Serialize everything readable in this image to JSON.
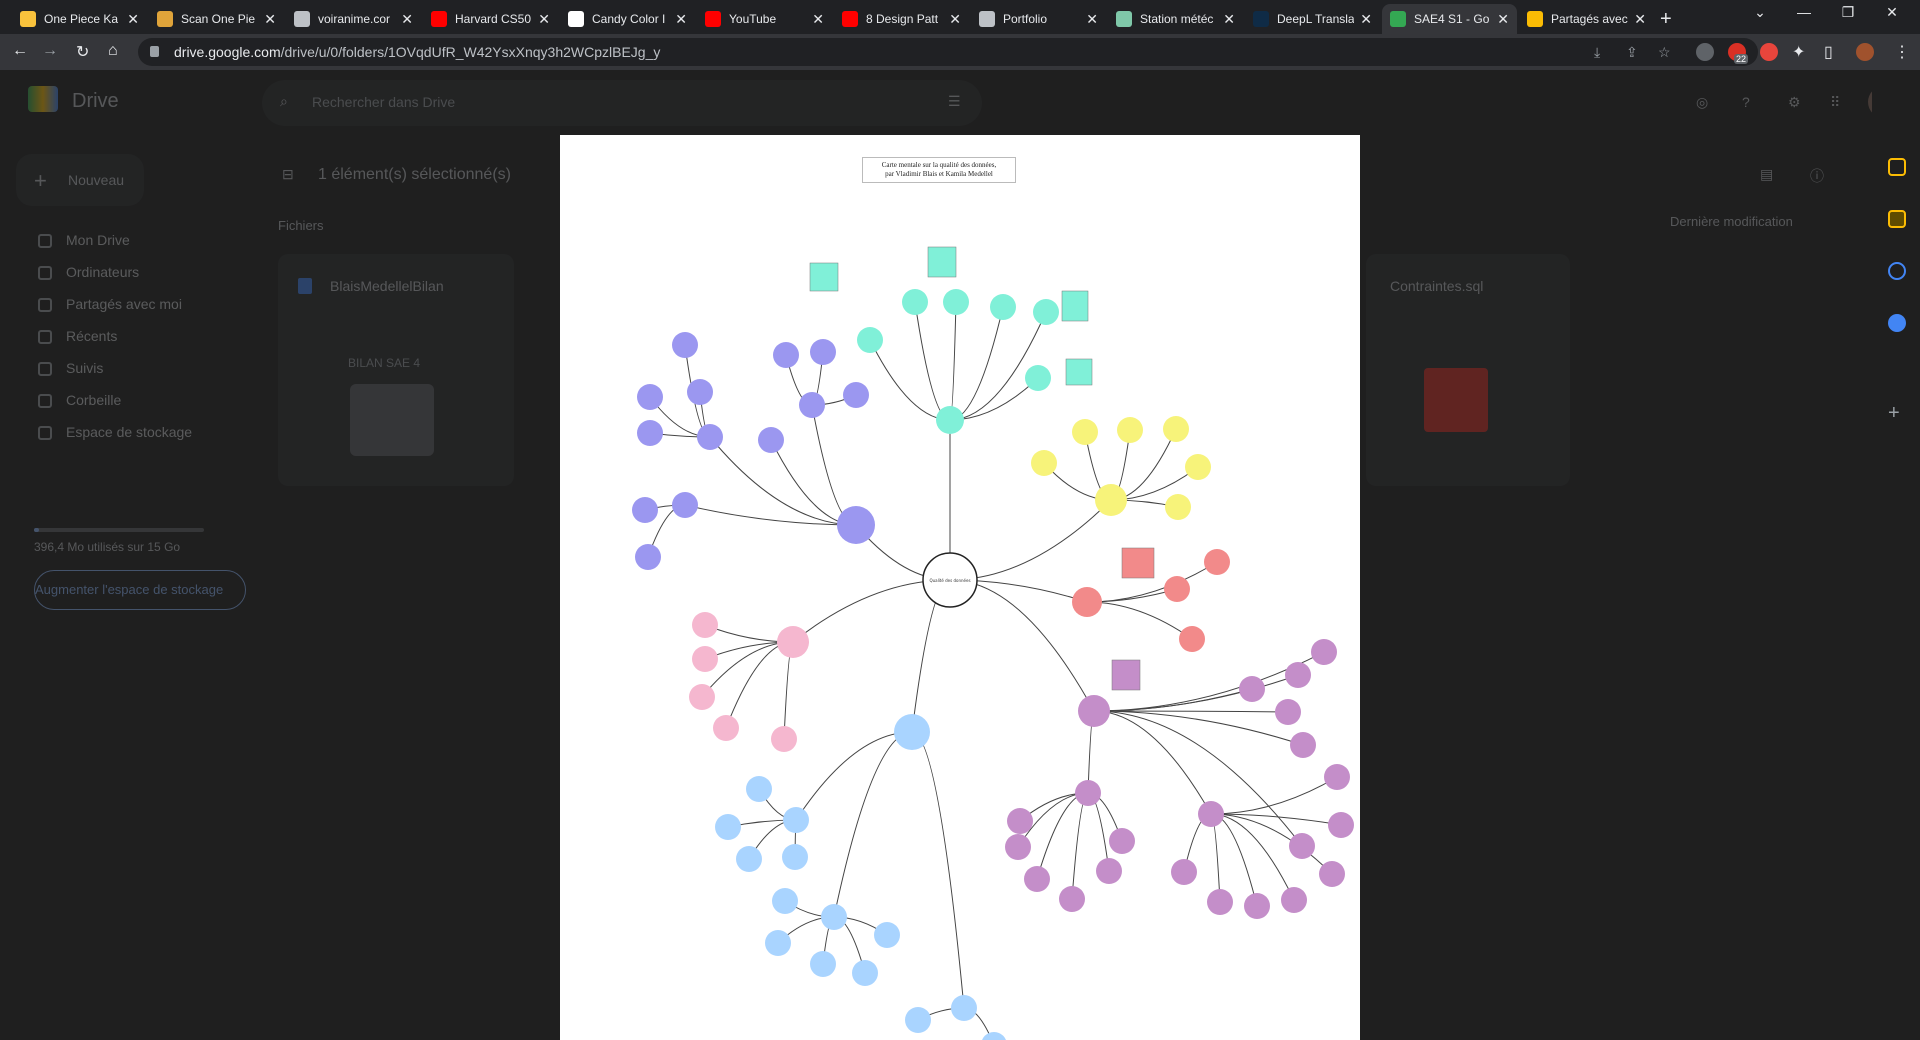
{
  "browser": {
    "tabs": [
      {
        "title": "One Piece Ka",
        "color": "#f9c23c",
        "active": false
      },
      {
        "title": "Scan One Pie",
        "color": "#e0a43a",
        "active": false
      },
      {
        "title": "voiranime.cor",
        "color": "#bdc1c6",
        "active": false
      },
      {
        "title": "Harvard CS50",
        "color": "#ff0000",
        "active": false
      },
      {
        "title": "Candy Color I",
        "color": "#ffffff",
        "active": false
      },
      {
        "title": "YouTube",
        "color": "#ff0000",
        "active": false
      },
      {
        "title": "8 Design Patt",
        "color": "#ff0000",
        "active": false
      },
      {
        "title": "Portfolio",
        "color": "#bdc1c6",
        "active": false
      },
      {
        "title": "Station météc",
        "color": "#7fc8a9",
        "active": false
      },
      {
        "title": "DeepL Transla",
        "color": "#0f2b46",
        "active": false
      },
      {
        "title": "SAE4 S1 - Go",
        "color": "#34a853",
        "active": true
      },
      {
        "title": "Partagés avec",
        "color": "#fbbc04",
        "active": false
      }
    ],
    "url_domain": "drive.google.com",
    "url_path": "/drive/u/0/folders/1OVqdUfR_W42YsxXnqy3h2WCpzlBEJg_y",
    "ext_badge": "22"
  },
  "drive": {
    "logo_text": "Drive",
    "search_placeholder": "Rechercher dans Drive",
    "new_button": "Nouveau",
    "selection_text": "1 élément(s) sélectionné(s)",
    "section_files": "Fichiers",
    "sort_label": "Dernière modification",
    "sidebar": [
      {
        "label": "Mon Drive"
      },
      {
        "label": "Ordinateurs"
      },
      {
        "label": "Partagés avec moi"
      },
      {
        "label": "Récents"
      },
      {
        "label": "Suivis"
      },
      {
        "label": "Corbeille"
      },
      {
        "label": "Espace de stockage"
      }
    ],
    "storage_used": "396,4 Mo utilisés sur 15 Go",
    "storage_fraction": 0.03,
    "storage_button": "Augmenter l'espace de stockage",
    "files": [
      {
        "name": "BlaisMedellelBilan",
        "thumb_text": "BILAN SAE 4"
      },
      {
        "name": "Contraintes.sql"
      }
    ]
  },
  "preview": {
    "title_line1": "Carte mentale sur la qualité des données,",
    "title_line2": "par Vladimir Blais et Kamila Medellel",
    "center_label": "Qualité des données"
  }
}
